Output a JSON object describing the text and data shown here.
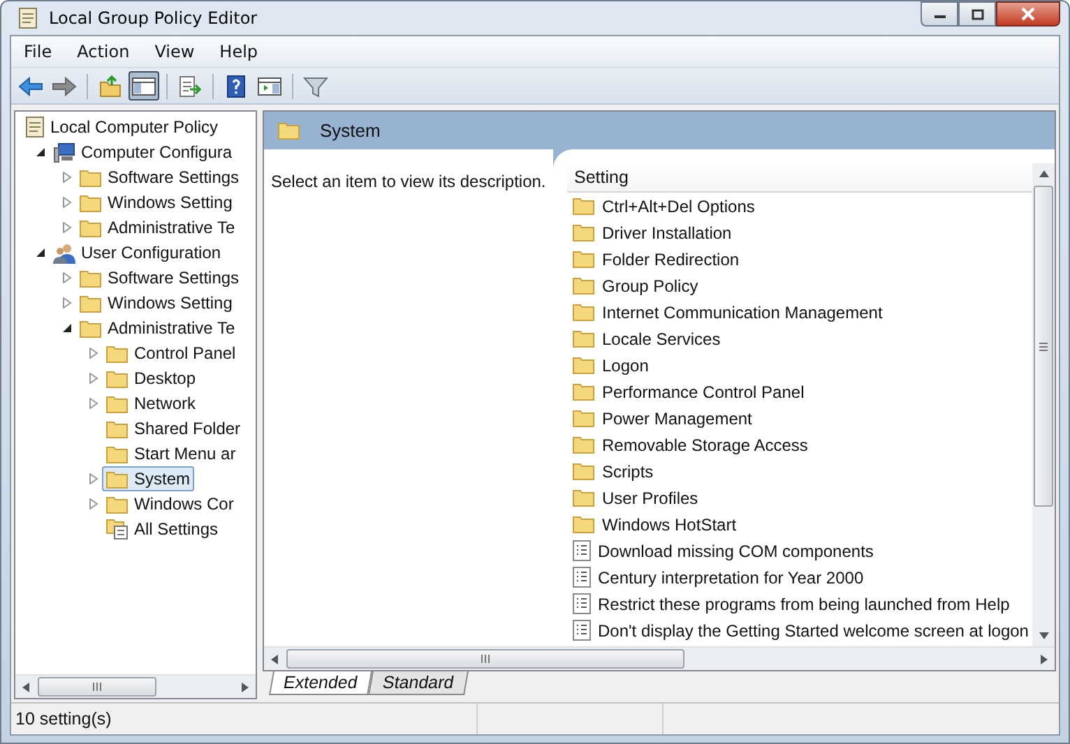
{
  "window": {
    "title": "Local Group Policy Editor"
  },
  "menu": [
    "File",
    "Action",
    "View",
    "Help"
  ],
  "toolbar": [
    [
      {
        "kind": "back",
        "pressed": false
      },
      {
        "kind": "forward",
        "pressed": false
      }
    ],
    [
      {
        "kind": "up",
        "pressed": false
      },
      {
        "kind": "tree",
        "pressed": true
      }
    ],
    [
      {
        "kind": "export",
        "pressed": false
      }
    ],
    [
      {
        "kind": "help",
        "pressed": false
      },
      {
        "kind": "pane",
        "pressed": false
      }
    ],
    [
      {
        "kind": "filter",
        "pressed": false
      }
    ]
  ],
  "tree": [
    {
      "label": "Local Computer Policy",
      "kind": "policy",
      "selected": false,
      "children": [
        {
          "label": "Computer Configura",
          "kind": "computer",
          "expanded": true,
          "selected": false,
          "children": [
            {
              "label": "Software Settings",
              "kind": "folder",
              "expanded": false,
              "selected": false
            },
            {
              "label": "Windows Setting",
              "kind": "folder",
              "expanded": false,
              "selected": false
            },
            {
              "label": "Administrative Te",
              "kind": "folder",
              "expanded": false,
              "selected": false
            }
          ]
        },
        {
          "label": "User Configuration",
          "kind": "user",
          "expanded": true,
          "selected": false,
          "children": [
            {
              "label": "Software Settings",
              "kind": "folder",
              "expanded": false,
              "selected": false
            },
            {
              "label": "Windows Setting",
              "kind": "folder",
              "expanded": false,
              "selected": false
            },
            {
              "label": "Administrative Te",
              "kind": "folder",
              "expanded": true,
              "selected": false,
              "children": [
                {
                  "label": "Control Panel",
                  "kind": "folder",
                  "expanded": false,
                  "selected": false
                },
                {
                  "label": "Desktop",
                  "kind": "folder",
                  "expanded": false,
                  "selected": false
                },
                {
                  "label": "Network",
                  "kind": "folder",
                  "expanded": false,
                  "selected": false
                },
                {
                  "label": "Shared Folder",
                  "kind": "folder",
                  "selected": false
                },
                {
                  "label": "Start Menu ar",
                  "kind": "folder",
                  "selected": false
                },
                {
                  "label": "System",
                  "kind": "folder",
                  "expanded": false,
                  "selected": true
                },
                {
                  "label": "Windows Cor",
                  "kind": "folder",
                  "expanded": false,
                  "selected": false
                },
                {
                  "label": "All Settings",
                  "kind": "settings",
                  "selected": false
                }
              ]
            }
          ]
        }
      ]
    }
  ],
  "details": {
    "title": "System",
    "description": "Select an item to view its description.",
    "column": "Setting",
    "rows": [
      {
        "kind": "folder",
        "label": "Ctrl+Alt+Del Options"
      },
      {
        "kind": "folder",
        "label": "Driver Installation"
      },
      {
        "kind": "folder",
        "label": "Folder Redirection"
      },
      {
        "kind": "folder",
        "label": "Group Policy"
      },
      {
        "kind": "folder",
        "label": "Internet Communication Management"
      },
      {
        "kind": "folder",
        "label": "Locale Services"
      },
      {
        "kind": "folder",
        "label": "Logon"
      },
      {
        "kind": "folder",
        "label": "Performance Control Panel"
      },
      {
        "kind": "folder",
        "label": "Power Management"
      },
      {
        "kind": "folder",
        "label": "Removable Storage Access"
      },
      {
        "kind": "folder",
        "label": "Scripts"
      },
      {
        "kind": "folder",
        "label": "User Profiles"
      },
      {
        "kind": "folder",
        "label": "Windows HotStart"
      },
      {
        "kind": "setting",
        "label": "Download missing COM components"
      },
      {
        "kind": "setting",
        "label": "Century interpretation for Year 2000"
      },
      {
        "kind": "setting",
        "label": "Restrict these programs from being launched from Help"
      },
      {
        "kind": "setting",
        "label": "Don't display the Getting Started welcome screen at logon"
      }
    ]
  },
  "view_tabs": [
    {
      "label": "Extended",
      "selected": true
    },
    {
      "label": "Standard",
      "selected": false
    }
  ],
  "status_bar": "10 setting(s)"
}
